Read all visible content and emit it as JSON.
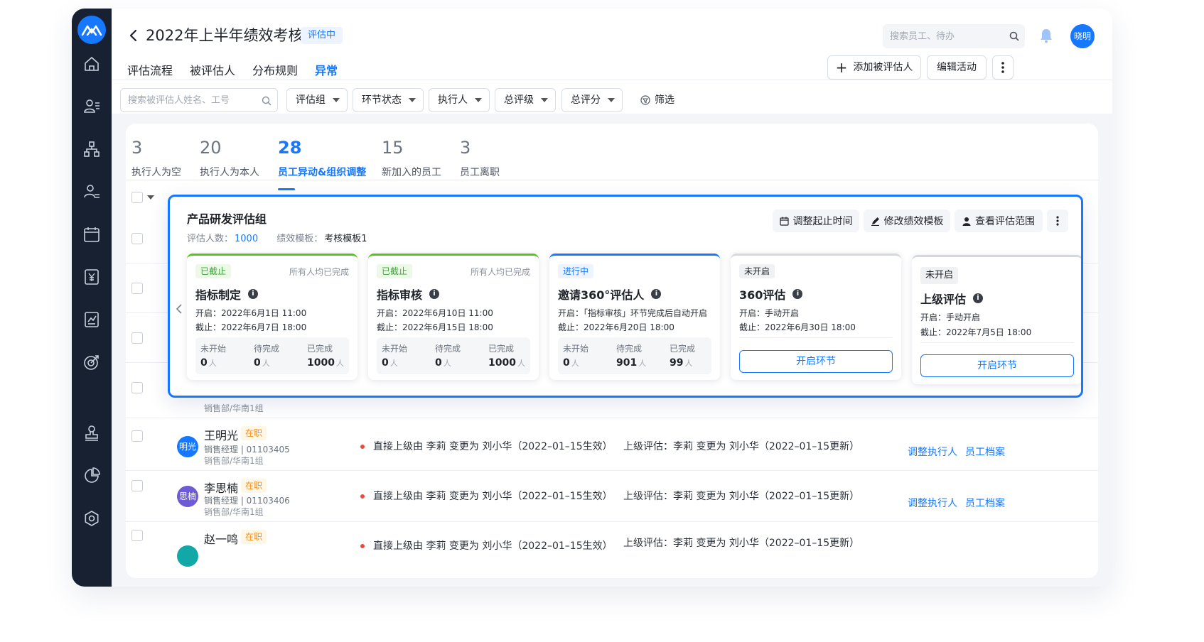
{
  "header": {
    "title": "2022年上半年绩效考核",
    "status": "评估中",
    "search_placeholder": "搜索员工、待办",
    "user_avatar": "晓明",
    "add_button": "添加被评估人",
    "edit_button": "编辑活动",
    "tabs": [
      {
        "label": "评估流程"
      },
      {
        "label": "被评估人"
      },
      {
        "label": "分布规则"
      },
      {
        "label": "异常"
      }
    ]
  },
  "filters": {
    "search_placeholder": "搜索被评估人姓名、工号",
    "dropdowns": [
      {
        "label": "评估组"
      },
      {
        "label": "环节状态"
      },
      {
        "label": "执行人"
      },
      {
        "label": "总评级"
      },
      {
        "label": "总评分"
      }
    ],
    "filter_label": "筛选"
  },
  "stats": [
    {
      "value": "3",
      "label": "执行人为空"
    },
    {
      "value": "20",
      "label": "执行人为本人"
    },
    {
      "value": "28",
      "label": "员工异动&组织调整"
    },
    {
      "value": "15",
      "label": "新加入的员工"
    },
    {
      "value": "3",
      "label": "员工离职"
    }
  ],
  "rows": [
    {
      "avatar": "明光",
      "name": "王明光",
      "status": "在职",
      "title_id": "销售经理 | 01103405",
      "dept": "销售部/华南1组",
      "change": "直接上级由 李莉 变更为 刘小华（2022–01–15生效）",
      "record": "上级评估：李莉 变更为 刘小华（2022–01–15更新）",
      "action1": "调整执行人",
      "action2": "员工档案"
    },
    {
      "avatar": "思楠",
      "name": "李思楠",
      "status": "在职",
      "title_id": "销售经理 | 01103406",
      "dept": "销售部/华南1组",
      "change": "直接上级由 李莉 变更为 刘小华（2022–01–15生效）",
      "record": "上级评估：李莉 变更为 刘小华（2022–01–15更新）",
      "action1": "调整执行人",
      "action2": "员工档案"
    },
    {
      "name": "赵一鸣",
      "status": "在职",
      "change": "直接上级由 李莉 变更为 刘小华（2022–01–15生效）",
      "record": "上级评估：李莉 变更为 刘小华（2022–01–15更新）"
    }
  ],
  "partial_dept": "销售部/华南1组",
  "popup": {
    "group_name": "产品研发评估组",
    "count_label": "评估人数：",
    "count_value": "1000",
    "template_label": "绩效模板：",
    "template_value": "考核模板1",
    "btn_time": "调整起止时间",
    "btn_template": "修改绩效模板",
    "btn_scope": "查看评估范围",
    "stages": [
      {
        "tag": "已截止",
        "note": "所有人均已完成",
        "name": "指标制定",
        "start": "开启：2022年6月1日 11:00",
        "end": "截止：2022年6月7日 18:00",
        "counts": [
          {
            "label": "未开始",
            "value": "0"
          },
          {
            "label": "待完成",
            "value": "0"
          },
          {
            "label": "已完成",
            "value": "1000"
          }
        ]
      },
      {
        "tag": "已截止",
        "note": "所有人均已完成",
        "name": "指标审核",
        "start": "开启：2022年6月10日 11:00",
        "end": "截止：2022年6月15日 18:00",
        "counts": [
          {
            "label": "未开始",
            "value": "0"
          },
          {
            "label": "待完成",
            "value": "0"
          },
          {
            "label": "已完成",
            "value": "1000"
          }
        ]
      },
      {
        "tag": "进行中",
        "note": "",
        "name": "邀请360°评估人",
        "start": "开启：「指标审核」环节完成后自动开启",
        "end": "截止：2022年6月20日 18:00",
        "counts": [
          {
            "label": "未开始",
            "value": "0"
          },
          {
            "label": "待完成",
            "value": "901"
          },
          {
            "label": "已完成",
            "value": "99"
          }
        ]
      },
      {
        "tag": "未开启",
        "note": "",
        "name": "360评估",
        "start": "开启：手动开启",
        "end": "截止：2022年6月30日 18:00",
        "button": "开启环节"
      },
      {
        "tag": "未开启",
        "note": "",
        "name": "上级评估",
        "start": "开启：手动开启",
        "end": "截止：2022年7月5日 18:00",
        "button": "开启环节"
      }
    ],
    "unit": "人"
  },
  "colors": {
    "accent": "#1677ff",
    "sidebar": "#182131",
    "done": "#52c41a",
    "warn": "#fa8c16",
    "alert": "#e84c3d"
  }
}
